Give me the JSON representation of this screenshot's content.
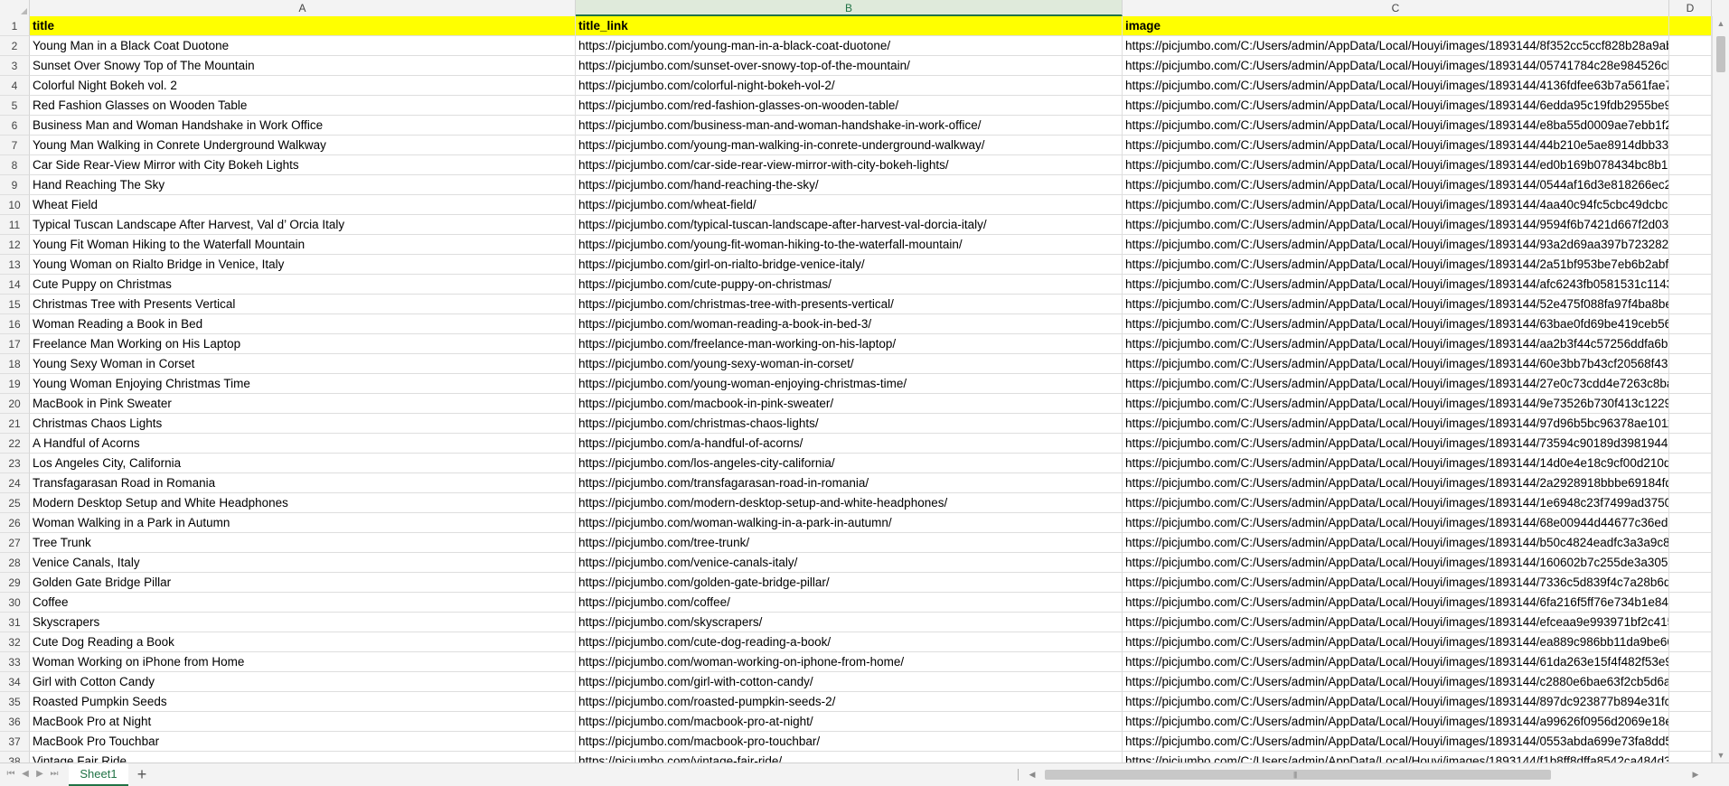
{
  "sheet": {
    "column_headers": [
      "A",
      "B",
      "C",
      "D"
    ],
    "selected_column": "B"
  },
  "header_row": {
    "row_number": "1",
    "cells": [
      "title",
      "title_link",
      "image",
      ""
    ]
  },
  "rows": [
    {
      "n": "2",
      "title": "Young Man in a Black Coat Duotone",
      "link": "https://picjumbo.com/young-man-in-a-black-coat-duotone/",
      "image": "https://picjumbo.com/C:/Users/admin/AppData/Local/Houyi/images/1893144/8f352cc5ccf828b28a9ab"
    },
    {
      "n": "3",
      "title": "Sunset Over Snowy Top of The Mountain",
      "link": "https://picjumbo.com/sunset-over-snowy-top-of-the-mountain/",
      "image": "https://picjumbo.com/C:/Users/admin/AppData/Local/Houyi/images/1893144/05741784c28e984526cb"
    },
    {
      "n": "4",
      "title": "Colorful Night Bokeh vol. 2",
      "link": "https://picjumbo.com/colorful-night-bokeh-vol-2/",
      "image": "https://picjumbo.com/C:/Users/admin/AppData/Local/Houyi/images/1893144/4136fdfee63b7a561fae7"
    },
    {
      "n": "5",
      "title": "Red Fashion Glasses on Wooden Table",
      "link": "https://picjumbo.com/red-fashion-glasses-on-wooden-table/",
      "image": "https://picjumbo.com/C:/Users/admin/AppData/Local/Houyi/images/1893144/6edda95c19fdb2955be9"
    },
    {
      "n": "6",
      "title": "Business Man and Woman Handshake in Work Office",
      "link": "https://picjumbo.com/business-man-and-woman-handshake-in-work-office/",
      "image": "https://picjumbo.com/C:/Users/admin/AppData/Local/Houyi/images/1893144/e8ba55d0009ae7ebb1f23"
    },
    {
      "n": "7",
      "title": "Young Man Walking in Conrete Underground Walkway",
      "link": "https://picjumbo.com/young-man-walking-in-conrete-underground-walkway/",
      "image": "https://picjumbo.com/C:/Users/admin/AppData/Local/Houyi/images/1893144/44b210e5ae8914dbb331"
    },
    {
      "n": "8",
      "title": "Car Side Rear-View Mirror with City Bokeh Lights",
      "link": "https://picjumbo.com/car-side-rear-view-mirror-with-city-bokeh-lights/",
      "image": "https://picjumbo.com/C:/Users/admin/AppData/Local/Houyi/images/1893144/ed0b169b078434bc8b12"
    },
    {
      "n": "9",
      "title": "Hand Reaching The Sky",
      "link": "https://picjumbo.com/hand-reaching-the-sky/",
      "image": "https://picjumbo.com/C:/Users/admin/AppData/Local/Houyi/images/1893144/0544af16d3e818266ec2c"
    },
    {
      "n": "10",
      "title": "Wheat Field",
      "link": "https://picjumbo.com/wheat-field/",
      "image": "https://picjumbo.com/C:/Users/admin/AppData/Local/Houyi/images/1893144/4aa40c94fc5cbc49dcbc3"
    },
    {
      "n": "11",
      "title": "Typical Tuscan Landscape After Harvest, Val d’ Orcia Italy",
      "link": "https://picjumbo.com/typical-tuscan-landscape-after-harvest-val-dorcia-italy/",
      "image": "https://picjumbo.com/C:/Users/admin/AppData/Local/Houyi/images/1893144/9594f6b7421d667f2d03a"
    },
    {
      "n": "12",
      "title": "Young Fit Woman Hiking to the Waterfall Mountain",
      "link": "https://picjumbo.com/young-fit-woman-hiking-to-the-waterfall-mountain/",
      "image": "https://picjumbo.com/C:/Users/admin/AppData/Local/Houyi/images/1893144/93a2d69aa397b7232820"
    },
    {
      "n": "13",
      "title": "Young Woman on Rialto Bridge in Venice, Italy",
      "link": "https://picjumbo.com/girl-on-rialto-bridge-venice-italy/",
      "image": "https://picjumbo.com/C:/Users/admin/AppData/Local/Houyi/images/1893144/2a51bf953be7eb6b2abfc"
    },
    {
      "n": "14",
      "title": "Cute Puppy on Christmas",
      "link": "https://picjumbo.com/cute-puppy-on-christmas/",
      "image": "https://picjumbo.com/C:/Users/admin/AppData/Local/Houyi/images/1893144/afc6243fb0581531c1143"
    },
    {
      "n": "15",
      "title": "Christmas Tree with Presents Vertical",
      "link": "https://picjumbo.com/christmas-tree-with-presents-vertical/",
      "image": "https://picjumbo.com/C:/Users/admin/AppData/Local/Houyi/images/1893144/52e475f088fa97f4ba8be"
    },
    {
      "n": "16",
      "title": "Woman Reading a Book in Bed",
      "link": "https://picjumbo.com/woman-reading-a-book-in-bed-3/",
      "image": "https://picjumbo.com/C:/Users/admin/AppData/Local/Houyi/images/1893144/63bae0fd69be419ceb565"
    },
    {
      "n": "17",
      "title": "Freelance Man Working on His Laptop",
      "link": "https://picjumbo.com/freelance-man-working-on-his-laptop/",
      "image": "https://picjumbo.com/C:/Users/admin/AppData/Local/Houyi/images/1893144/aa2b3f44c57256ddfa6b9"
    },
    {
      "n": "18",
      "title": "Young Sexy Woman in Corset",
      "link": "https://picjumbo.com/young-sexy-woman-in-corset/",
      "image": "https://picjumbo.com/C:/Users/admin/AppData/Local/Houyi/images/1893144/60e3bb7b43cf20568f436"
    },
    {
      "n": "19",
      "title": "Young Woman Enjoying Christmas Time",
      "link": "https://picjumbo.com/young-woman-enjoying-christmas-time/",
      "image": "https://picjumbo.com/C:/Users/admin/AppData/Local/Houyi/images/1893144/27e0c73cdd4e7263c8baa"
    },
    {
      "n": "20",
      "title": "MacBook in Pink Sweater",
      "link": "https://picjumbo.com/macbook-in-pink-sweater/",
      "image": "https://picjumbo.com/C:/Users/admin/AppData/Local/Houyi/images/1893144/9e73526b730f413c1229"
    },
    {
      "n": "21",
      "title": "Christmas Chaos Lights",
      "link": "https://picjumbo.com/christmas-chaos-lights/",
      "image": "https://picjumbo.com/C:/Users/admin/AppData/Local/Houyi/images/1893144/97d96b5bc96378ae1011"
    },
    {
      "n": "22",
      "title": "A Handful of Acorns",
      "link": "https://picjumbo.com/a-handful-of-acorns/",
      "image": "https://picjumbo.com/C:/Users/admin/AppData/Local/Houyi/images/1893144/73594c90189d3981944c"
    },
    {
      "n": "23",
      "title": "Los Angeles City, California",
      "link": "https://picjumbo.com/los-angeles-city-california/",
      "image": "https://picjumbo.com/C:/Users/admin/AppData/Local/Houyi/images/1893144/14d0e4e18c9cf00d210db"
    },
    {
      "n": "24",
      "title": "Transfagarasan Road in Romania",
      "link": "https://picjumbo.com/transfagarasan-road-in-romania/",
      "image": "https://picjumbo.com/C:/Users/admin/AppData/Local/Houyi/images/1893144/2a2928918bbbe69184fd"
    },
    {
      "n": "25",
      "title": "Modern Desktop Setup and White Headphones",
      "link": "https://picjumbo.com/modern-desktop-setup-and-white-headphones/",
      "image": "https://picjumbo.com/C:/Users/admin/AppData/Local/Houyi/images/1893144/1e6948c23f7499ad37508"
    },
    {
      "n": "26",
      "title": "Woman Walking in a Park in Autumn",
      "link": "https://picjumbo.com/woman-walking-in-a-park-in-autumn/",
      "image": "https://picjumbo.com/C:/Users/admin/AppData/Local/Houyi/images/1893144/68e00944d44677c36ed5"
    },
    {
      "n": "27",
      "title": "Tree Trunk",
      "link": "https://picjumbo.com/tree-trunk/",
      "image": "https://picjumbo.com/C:/Users/admin/AppData/Local/Houyi/images/1893144/b50c4824eadfc3a3a9c89"
    },
    {
      "n": "28",
      "title": "Venice Canals, Italy",
      "link": "https://picjumbo.com/venice-canals-italy/",
      "image": "https://picjumbo.com/C:/Users/admin/AppData/Local/Houyi/images/1893144/160602b7c255de3a3056"
    },
    {
      "n": "29",
      "title": "Golden Gate Bridge Pillar",
      "link": "https://picjumbo.com/golden-gate-bridge-pillar/",
      "image": "https://picjumbo.com/C:/Users/admin/AppData/Local/Houyi/images/1893144/7336c5d839f4c7a28b6db"
    },
    {
      "n": "30",
      "title": "Coffee",
      "link": "https://picjumbo.com/coffee/",
      "image": "https://picjumbo.com/C:/Users/admin/AppData/Local/Houyi/images/1893144/6fa216f5ff76e734b1e84f"
    },
    {
      "n": "31",
      "title": "Skyscrapers",
      "link": "https://picjumbo.com/skyscrapers/",
      "image": "https://picjumbo.com/C:/Users/admin/AppData/Local/Houyi/images/1893144/efceaa9e993971bf2c415"
    },
    {
      "n": "32",
      "title": "Cute Dog Reading a Book",
      "link": "https://picjumbo.com/cute-dog-reading-a-book/",
      "image": "https://picjumbo.com/C:/Users/admin/AppData/Local/Houyi/images/1893144/ea889c986bb11da9be66"
    },
    {
      "n": "33",
      "title": "Woman Working on iPhone from Home",
      "link": "https://picjumbo.com/woman-working-on-iphone-from-home/",
      "image": "https://picjumbo.com/C:/Users/admin/AppData/Local/Houyi/images/1893144/61da263e15f4f482f53e9"
    },
    {
      "n": "34",
      "title": "Girl with Cotton Candy",
      "link": "https://picjumbo.com/girl-with-cotton-candy/",
      "image": "https://picjumbo.com/C:/Users/admin/AppData/Local/Houyi/images/1893144/c2880e6bae63f2cb5d6a9"
    },
    {
      "n": "35",
      "title": "Roasted Pumpkin Seeds",
      "link": "https://picjumbo.com/roasted-pumpkin-seeds-2/",
      "image": "https://picjumbo.com/C:/Users/admin/AppData/Local/Houyi/images/1893144/897dc923877b894e31fc"
    },
    {
      "n": "36",
      "title": "MacBook Pro at Night",
      "link": "https://picjumbo.com/macbook-pro-at-night/",
      "image": "https://picjumbo.com/C:/Users/admin/AppData/Local/Houyi/images/1893144/a99626f0956d2069e18e"
    },
    {
      "n": "37",
      "title": "MacBook Pro Touchbar",
      "link": "https://picjumbo.com/macbook-pro-touchbar/",
      "image": "https://picjumbo.com/C:/Users/admin/AppData/Local/Houyi/images/1893144/0553abda699e73fa8dd56"
    },
    {
      "n": "38",
      "title": "Vintage Fair Ride",
      "link": "https://picjumbo.com/vintage-fair-ride/",
      "image": "https://picjumbo.com/C:/Users/admin/AppData/Local/Houyi/images/1893144/f1b8ff8dffa8542ca484d3"
    }
  ],
  "bottom_bar": {
    "sheet_tab": "Sheet1",
    "add_sheet_label": "+",
    "nav_icons": [
      "first-sheet-icon",
      "prev-sheet-icon",
      "next-sheet-icon",
      "last-sheet-icon"
    ]
  },
  "colors": {
    "header_fill": "#ffff00",
    "accent": "#217346",
    "selected_column_fill": "#dfeadb"
  }
}
